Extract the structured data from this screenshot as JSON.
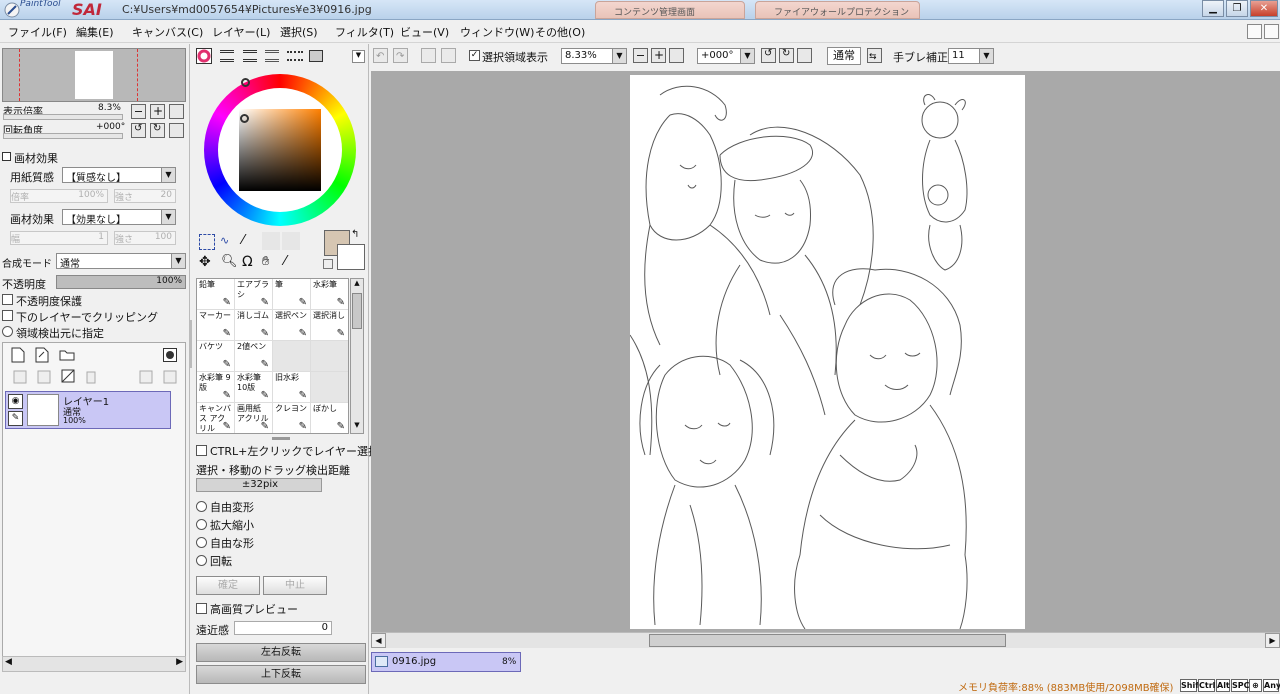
{
  "app": {
    "logo_small": "PaintTool",
    "logo_big": "SAI",
    "title": "C:¥Users¥md0057654¥Pictures¥e3¥0916.jpg",
    "bg_tabs": [
      "コンテンツ管理画面",
      "ファイアウォールプロテクション"
    ]
  },
  "menu": [
    "ファイル(F)",
    "編集(E)",
    "キャンバス(C)",
    "レイヤー(L)",
    "選択(S)",
    "フィルタ(T)",
    "ビュー(V)",
    "ウィンドウ(W)",
    "その他(O)"
  ],
  "nav": {
    "zoom_label": "表示倍率",
    "zoom_value": "8.3%",
    "rotate_label": "回転角度",
    "rotate_value": "+000°"
  },
  "brush_effect": {
    "header": "画材効果",
    "paper_label": "用紙質感",
    "paper_value": "【質感なし】",
    "paper_scale_label": "倍率",
    "paper_scale_value": "100%",
    "paper_strength_label": "強さ",
    "paper_strength_value": "20",
    "effect_label": "画材効果",
    "effect_value": "【効果なし】",
    "effect_width_label": "幅",
    "effect_width_value": "1",
    "effect_strength_label": "強さ",
    "effect_strength_value": "100"
  },
  "layer_props": {
    "blend_label": "合成モード",
    "blend_value": "通常",
    "opacity_label": "不透明度",
    "opacity_value": "100%",
    "opacity_level": 1.0,
    "protect_opacity": "不透明度保護",
    "clip_lower": "下のレイヤーでクリッピング",
    "selection_source": "領域検出元に指定"
  },
  "layer": {
    "name": "レイヤー1",
    "mode": "通常",
    "opacity": "100%"
  },
  "tools": [
    {
      "label": "鉛筆"
    },
    {
      "label": "エアブラシ"
    },
    {
      "label": "筆"
    },
    {
      "label": "水彩筆"
    },
    {
      "label": "マーカー"
    },
    {
      "label": "消しゴム"
    },
    {
      "label": "選択ペン"
    },
    {
      "label": "選択消し"
    },
    {
      "label": "バケツ"
    },
    {
      "label": "2値ペン"
    },
    {
      "label": ""
    },
    {
      "label": ""
    },
    {
      "label": "水彩筆 9版"
    },
    {
      "label": "水彩筆 10版"
    },
    {
      "label": "旧水彩"
    },
    {
      "label": ""
    },
    {
      "label": "キャンバス アクリル"
    },
    {
      "label": "画用紙 アクリル"
    },
    {
      "label": "クレヨン"
    },
    {
      "label": "ぼかし"
    }
  ],
  "tool_options": {
    "ctrl_click": "CTRL+左クリックでレイヤー選択",
    "drag_label": "選択・移動のドラッグ検出距離",
    "drag_value": "±32pix",
    "transforms": [
      "自由変形",
      "拡大縮小",
      "自由な形",
      "回転"
    ],
    "ok": "確定",
    "cancel": "中止",
    "hq_preview": "高画質プレビュー",
    "perspective_label": "遠近感",
    "perspective_value": "0",
    "flip_h": "左右反転",
    "flip_v": "上下反転"
  },
  "colors": {
    "primary": "#d6c6b2",
    "secondary": "#ffffff",
    "accent": "#c9c7f5"
  },
  "canvas_toolbar": {
    "show_selection": "選択領域表示",
    "zoom": "8.33%",
    "rotate": "+000°",
    "blend": "通常",
    "stabilizer_label": "手ブレ補正",
    "stabilizer_value": "11"
  },
  "doc_tab": {
    "name": "0916.jpg",
    "zoom": "8%"
  },
  "status": {
    "memory": "メモリ負荷率:88% (883MB使用/2098MB確保)",
    "keys": [
      "Shift",
      "Ctrl",
      "Alt",
      "SPC",
      "⊕",
      "Any"
    ]
  }
}
